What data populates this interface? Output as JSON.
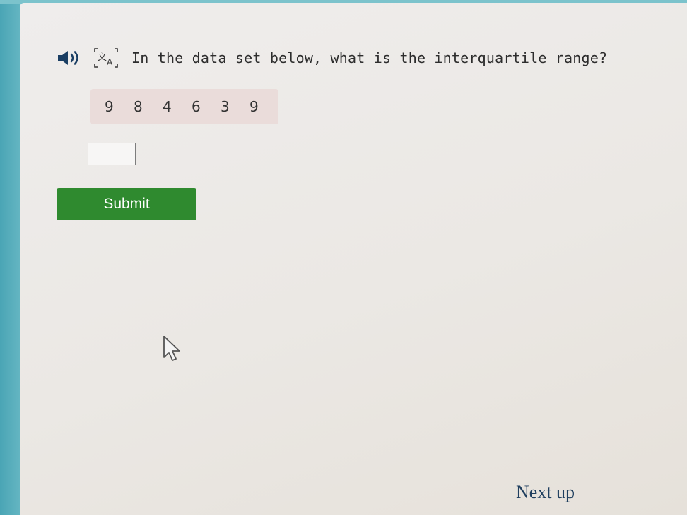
{
  "question": {
    "text": "In the data set below, what is the interquartile range?",
    "speaker_icon": "speaker-icon",
    "translate_icon": "translate-icon"
  },
  "data_set": {
    "values": [
      "9",
      "8",
      "4",
      "6",
      "3",
      "9"
    ]
  },
  "answer": {
    "value": ""
  },
  "submit": {
    "label": "Submit"
  },
  "footer": {
    "next_label": "Next up"
  },
  "colors": {
    "submit_bg": "#2f8a2f",
    "data_box_bg": "#eadcda",
    "next_text": "#1f3e5e",
    "background_teal": "#5fb3c0"
  }
}
